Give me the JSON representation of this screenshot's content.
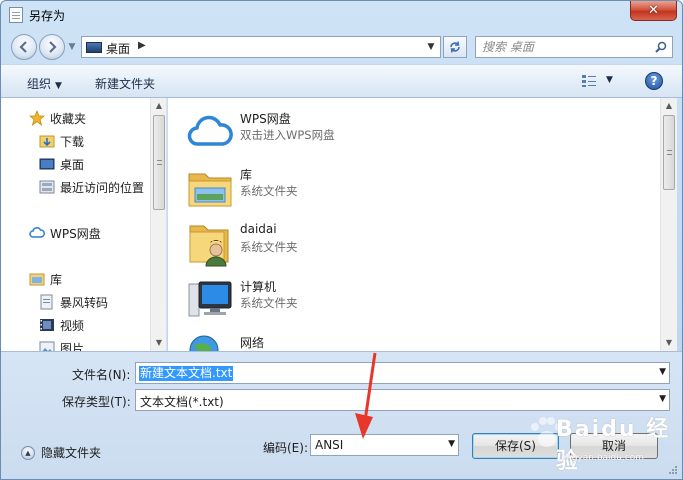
{
  "window": {
    "title": "另存为",
    "close_label": "✕"
  },
  "address": {
    "location": "桌面",
    "search_placeholder": "搜索 桌面"
  },
  "toolbar": {
    "organize_label": "组织",
    "new_folder_label": "新建文件夹",
    "help_label": "?"
  },
  "nav_pane": {
    "items": [
      {
        "label": "收藏夹",
        "icon": "star-icon"
      },
      {
        "label": "下载",
        "icon": "download-folder-icon"
      },
      {
        "label": "桌面",
        "icon": "desktop-icon"
      },
      {
        "label": "最近访问的位置",
        "icon": "recent-places-icon"
      },
      {
        "label": "WPS网盘",
        "icon": "cloud-icon"
      },
      {
        "label": "库",
        "icon": "library-icon"
      },
      {
        "label": "暴风转码",
        "icon": "document-icon"
      },
      {
        "label": "视频",
        "icon": "video-icon"
      },
      {
        "label": "图片",
        "icon": "picture-icon"
      }
    ]
  },
  "files": [
    {
      "name": "WPS网盘",
      "desc": "双击进入WPS网盘",
      "icon": "cloud-icon"
    },
    {
      "name": "库",
      "desc": "系统文件夹",
      "icon": "library-folder-icon"
    },
    {
      "name": "daidai",
      "desc": "系统文件夹",
      "icon": "user-folder-icon"
    },
    {
      "name": "计算机",
      "desc": "系统文件夹",
      "icon": "computer-icon"
    },
    {
      "name": "网络",
      "desc": "",
      "icon": "network-icon"
    }
  ],
  "form": {
    "filename_label": "文件名(N):",
    "filename_value": "新建文本文档.txt",
    "savetype_label": "保存类型(T):",
    "savetype_value": "文本文档(*.txt)",
    "hide_folders_label": "隐藏文件夹",
    "encoding_label": "编码(E):",
    "encoding_value": "ANSI",
    "save_label": "保存(S)",
    "cancel_label": "取消"
  },
  "watermark": {
    "text": "Baidu 经验",
    "sub": "jingyan.baidu.com"
  },
  "colors": {
    "selection": "#3399ff",
    "annotation_arrow": "#e8372a",
    "close_button": "#c7402b"
  }
}
